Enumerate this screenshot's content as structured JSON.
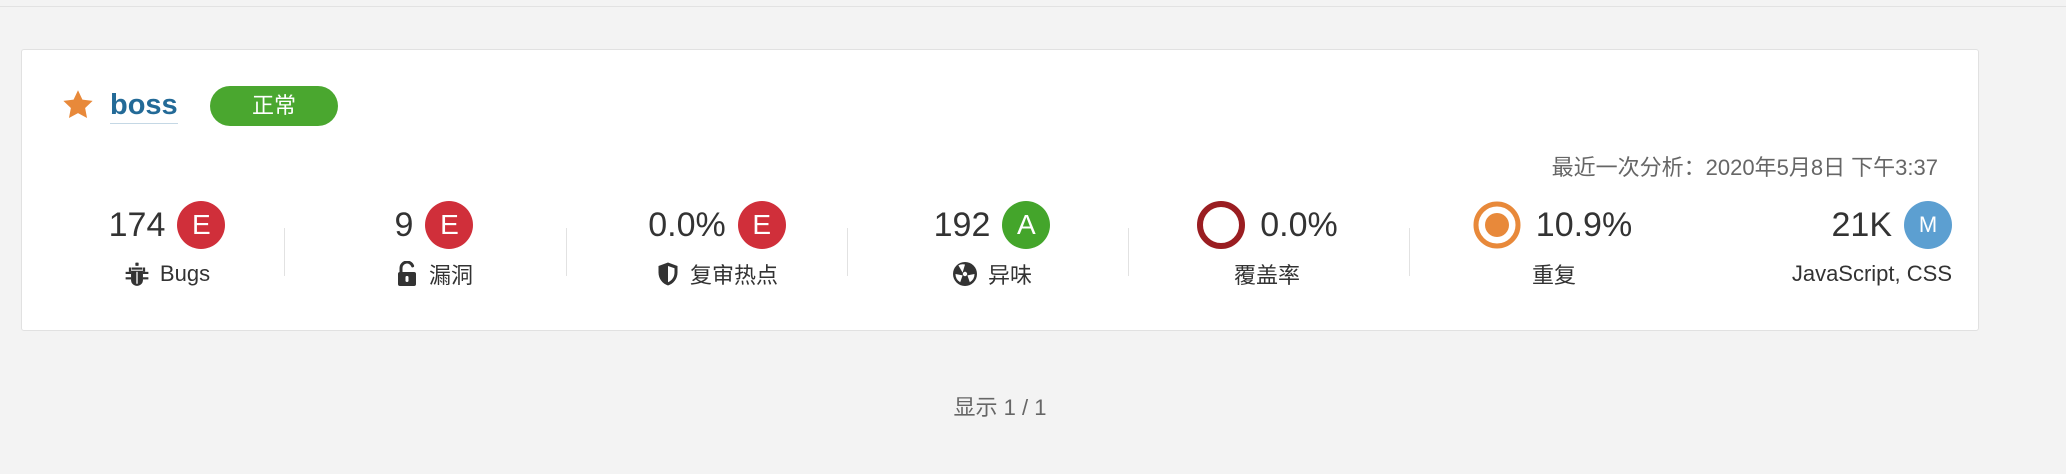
{
  "project": {
    "name": "boss",
    "status": "正常",
    "last_analysis": "最近一次分析：2020年5月8日 下午3:37"
  },
  "metrics": {
    "bugs": {
      "value": "174",
      "rating": "E",
      "label": "Bugs"
    },
    "vulnerabilities": {
      "value": "9",
      "rating": "E",
      "label": "漏洞"
    },
    "hotspots": {
      "value": "0.0%",
      "rating": "E",
      "label": "复审热点"
    },
    "smells": {
      "value": "192",
      "rating": "A",
      "label": "异味"
    },
    "coverage": {
      "value": "0.0%",
      "label": "覆盖率"
    },
    "duplications": {
      "value": "10.9%",
      "label": "重复"
    },
    "size": {
      "value": "21K",
      "rating": "M",
      "label": "JavaScript, CSS"
    }
  },
  "pagination": {
    "text": "显示 1 / 1"
  },
  "icons": {
    "star": "star-icon",
    "bugs": "bug-icon",
    "vulnerabilities": "unlock-icon",
    "hotspots": "shield-icon",
    "smells": "radiation-icon",
    "coverage": "coverage-donut-icon",
    "duplications": "duplication-donut-icon"
  },
  "colors": {
    "star": "#e8893a",
    "link": "#236a97",
    "status_ok": "#4aa72f",
    "rating_e": "#d02f3a",
    "rating_a": "#44a52b",
    "size_badge": "#5c9fd1",
    "coverage_ring": "#9a1d21",
    "duplication_ring": "#e8893a"
  }
}
